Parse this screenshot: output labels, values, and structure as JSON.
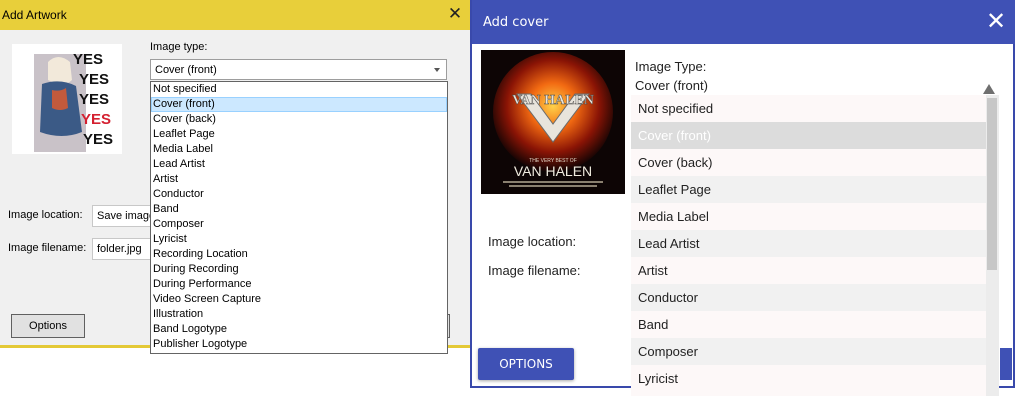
{
  "left": {
    "title": "Add Artwork",
    "close_icon": "close-icon",
    "image_type_label": "Image type:",
    "image_type_value": "Cover (front)",
    "image_location_label": "Image location:",
    "image_location_value": "Save image",
    "image_filename_label": "Image filename:",
    "image_filename_value": "folder.jpg",
    "options_label": "Options",
    "options": [
      "Not specified",
      "Cover (front)",
      "Cover (back)",
      "Leaflet Page",
      "Media Label",
      "Lead Artist",
      "Artist",
      "Conductor",
      "Band",
      "Composer",
      "Lyricist",
      "Recording Location",
      "During Recording",
      "During Performance",
      "Video Screen Capture",
      "Illustration",
      "Band Logotype",
      "Publisher Logotype"
    ],
    "selected_index": 1,
    "artwork_text": [
      "YES",
      "YES",
      "YES",
      "YES",
      "YES"
    ],
    "colors": {
      "titlebar": "#e8cf3a",
      "selection": "#cce8ff"
    }
  },
  "right": {
    "title": "Add cover",
    "close_icon": "close-icon",
    "image_type_label": "Image Type:",
    "image_type_value": "Cover (front)",
    "image_location_label": "Image location:",
    "image_filename_label": "Image filename:",
    "options_label": "OPTIONS",
    "options": [
      "Not specified",
      "Cover (front)",
      "Cover (back)",
      "Leaflet Page",
      "Media Label",
      "Lead Artist",
      "Artist",
      "Conductor",
      "Band",
      "Composer",
      "Lyricist"
    ],
    "selected_index": 1,
    "artwork_logo": "VAN HALEN",
    "artwork_subtitle": "THE VERY BEST OF",
    "artwork_band": "VAN HALEN",
    "colors": {
      "header": "#3f51b5",
      "selection": "#dcdcdc"
    }
  }
}
